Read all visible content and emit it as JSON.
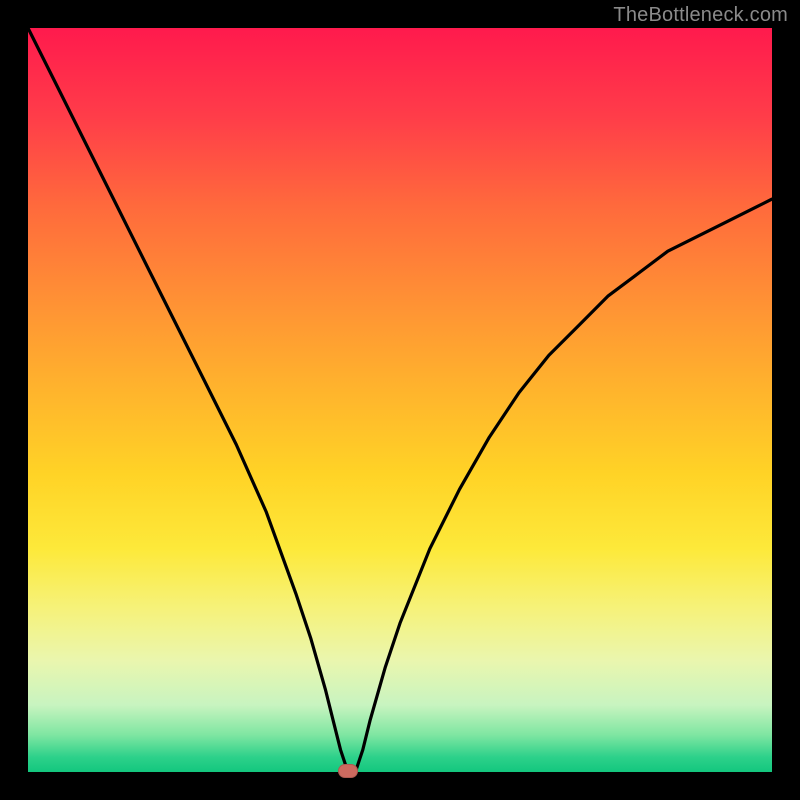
{
  "watermark": {
    "text": "TheBottleneck.com"
  },
  "colors": {
    "background": "#000000",
    "gradient_top": "#ff1a4d",
    "gradient_bottom": "#13c77e",
    "curve": "#000000",
    "marker": "#cc6a5f"
  },
  "chart_data": {
    "type": "line",
    "title": "",
    "xlabel": "",
    "ylabel": "",
    "xlim": [
      0,
      100
    ],
    "ylim": [
      0,
      100
    ],
    "grid": false,
    "legend": false,
    "annotations": [
      {
        "name": "marker",
        "x": 43,
        "y": 0
      }
    ],
    "series": [
      {
        "name": "curve",
        "x": [
          0,
          4,
          8,
          12,
          16,
          20,
          24,
          28,
          32,
          36,
          38,
          40,
          41,
          42,
          43,
          44,
          45,
          46,
          48,
          50,
          54,
          58,
          62,
          66,
          70,
          74,
          78,
          82,
          86,
          90,
          94,
          98,
          100
        ],
        "y": [
          100,
          92,
          84,
          76,
          68,
          60,
          52,
          44,
          35,
          24,
          18,
          11,
          7,
          3,
          0,
          0,
          3,
          7,
          14,
          20,
          30,
          38,
          45,
          51,
          56,
          60,
          64,
          67,
          70,
          72,
          74,
          76,
          77
        ]
      }
    ]
  }
}
